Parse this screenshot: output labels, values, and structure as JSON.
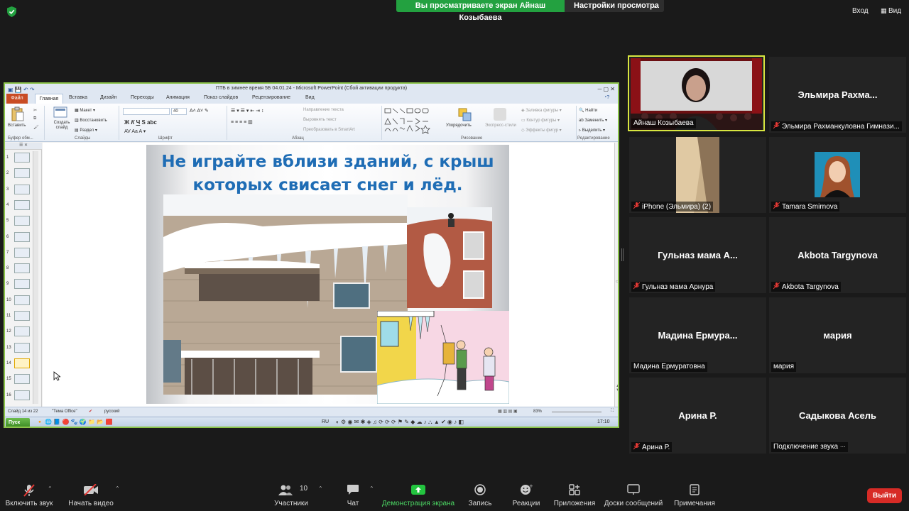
{
  "topbar": {
    "share_banner": "Вы просматриваете экран Айнаш Козыбаева",
    "view_settings": "Настройки просмотра",
    "enter": "Вход",
    "view": "Вид"
  },
  "powerpoint": {
    "window_title": "ПТБ в зимнее время 5Б 04.01.24 - Microsoft PowerPoint (Сбой активации продукта)",
    "tabs": [
      "Файл",
      "Главная",
      "Вставка",
      "Дизайн",
      "Переходы",
      "Анимация",
      "Показ слайдов",
      "Рецензирование",
      "Вид"
    ],
    "ribbon": {
      "paste": "Вставить",
      "new_slide": "Создать слайд",
      "layout": "Макет",
      "reset": "Восстановить",
      "section": "Раздел",
      "font_size": "40",
      "text_direction": "Направление текста",
      "align_text": "Выровнять текст",
      "smartart": "Преобразовать в SmartArt",
      "arrange": "Упорядочить",
      "quick_styles": "Экспресс-стили",
      "shape_fill": "Заливка фигуры",
      "shape_outline": "Контур фигуры",
      "shape_effects": "Эффекты фигур",
      "find": "Найти",
      "replace": "Заменить",
      "select": "Выделить",
      "groups": {
        "clipboard": "Буфер обм...",
        "slides": "Слайды",
        "font": "Шрифт",
        "paragraph": "Абзац",
        "drawing": "Рисование",
        "editing": "Редактирование"
      }
    },
    "thumbnails": [
      "1",
      "2",
      "3",
      "4",
      "5",
      "6",
      "7",
      "8",
      "9",
      "10",
      "11",
      "12",
      "13",
      "14",
      "15",
      "16"
    ],
    "slide_title": "Не играйте вблизи зданий, с крыш которых свисает снег и лёд.",
    "status": {
      "slide": "Слайд 14 из 22",
      "theme": "\"Тема Office\"",
      "language": "русский",
      "zoom": "83%"
    },
    "taskbar": {
      "start": "Пуск",
      "lang": "RU",
      "time": "17:10"
    }
  },
  "participants": [
    {
      "display": "",
      "label": "Айнаш Козыбаева",
      "muted": false,
      "video": true
    },
    {
      "display": "Эльмира  Рахма...",
      "label": "Эльмира Рахманкуловна Гимнази...",
      "muted": true
    },
    {
      "display": "",
      "label": "iPhone (Эльмира) (2)",
      "muted": true,
      "video": true
    },
    {
      "display": "",
      "label": "Tamara Smirnova",
      "muted": true,
      "video": true
    },
    {
      "display": "Гульназ мама  А...",
      "label": "Гульназ мама Арнура",
      "muted": true
    },
    {
      "display": "Akbota Targynova",
      "label": "Akbota Targynova",
      "muted": true
    },
    {
      "display": "Мадина  Ермура...",
      "label": "Мадина Ермуратовна",
      "muted": false
    },
    {
      "display": "мария",
      "label": "мария",
      "muted": false
    },
    {
      "display": "Арина Р.",
      "label": "Арина Р.",
      "muted": true
    },
    {
      "display": "Садыкова  Асель",
      "label": "Подключение звука",
      "muted": false
    }
  ],
  "toolbar": {
    "unmute": "Включить звук",
    "start_video": "Начать видео",
    "participants": "Участники",
    "participants_count": "10",
    "chat": "Чат",
    "share_screen": "Демонстрация экрана",
    "record": "Запись",
    "reactions": "Реакции",
    "apps": "Приложения",
    "whiteboards": "Доски сообщений",
    "notes": "Примечания",
    "leave": "Выйти"
  },
  "colors": {
    "share_green": "#23a140",
    "leave_red": "#d72b26",
    "active_speaker": "#d8e640",
    "slide_title_blue": "#1f6db5"
  }
}
